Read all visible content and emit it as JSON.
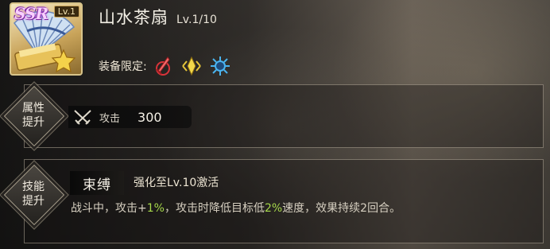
{
  "item": {
    "rarity": "SSR",
    "level_tag": "Lv.1",
    "name": "山水茶扇",
    "level": "Lv.1/10",
    "icon": "folding-fan-with-gold-bar"
  },
  "restriction": {
    "label": "装备限定:",
    "roles": [
      {
        "icon": "red-sword-role-icon",
        "color": "#d8343a"
      },
      {
        "icon": "gold-diamond-role-icon",
        "color": "#e6c63a"
      },
      {
        "icon": "blue-sun-role-icon",
        "color": "#4ab4f0"
      }
    ]
  },
  "attributes": {
    "section_label_1": "属性",
    "section_label_2": "提升",
    "stat_icon": "crossed-swords-icon",
    "stat_name": "攻击",
    "stat_value": "300"
  },
  "skill": {
    "section_label_1": "技能",
    "section_label_2": "提升",
    "name": "束缚",
    "unlock_text": "强化至Lv.10激活",
    "desc_1": "战斗中，攻击+",
    "desc_value_1": "1%",
    "desc_2": "，攻击时降低目标低",
    "desc_value_2": "2%",
    "desc_3": "速度，效果持续2回合。",
    "highlight_color": "#a6d84a"
  }
}
